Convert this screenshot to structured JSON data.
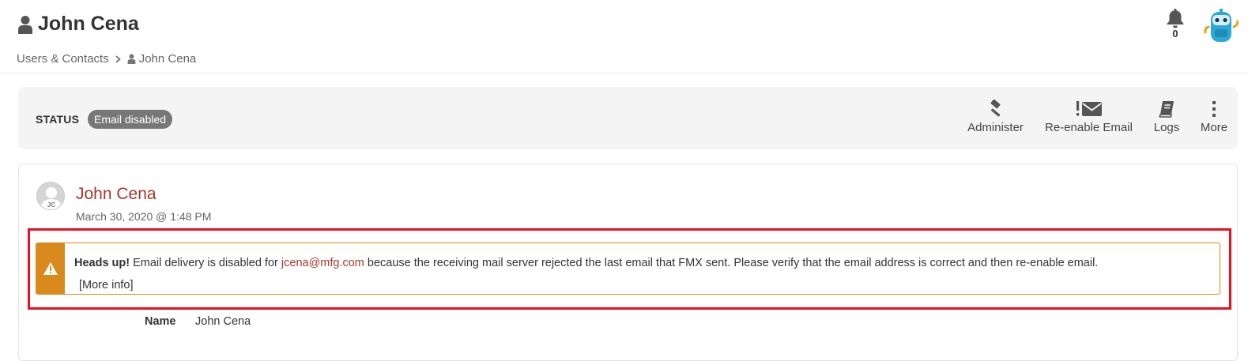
{
  "header": {
    "title": "John Cena",
    "breadcrumb": {
      "parent": "Users & Contacts",
      "current": "John Cena"
    },
    "notifications": {
      "count": "0"
    }
  },
  "status": {
    "label": "STATUS",
    "badge": "Email disabled",
    "actions": [
      {
        "label": "Administer",
        "icon": "gavel-icon"
      },
      {
        "label": "Re-enable Email",
        "icon": "email-alert-icon"
      },
      {
        "label": "Logs",
        "icon": "book-icon"
      },
      {
        "label": "More",
        "icon": "vertical-dots-icon"
      }
    ]
  },
  "record": {
    "initials": "JC",
    "name": "John Cena",
    "date": "March 30, 2020 @ 1:48 PM"
  },
  "alert": {
    "lead": "Heads up!",
    "text_before": " Email delivery is disabled for ",
    "email": "jcena@mfg.com",
    "text_after": " because the receiving mail server rejected the last email that FMX sent. Please verify that the email address is correct and then re-enable email.",
    "more_info": "[More info]"
  },
  "fields": {
    "name_label": "Name",
    "name_value": "John Cena"
  },
  "colors": {
    "accent": "#a6382c",
    "warning": "#d98a1c",
    "highlight": "#e8101e",
    "badge": "#777777"
  }
}
